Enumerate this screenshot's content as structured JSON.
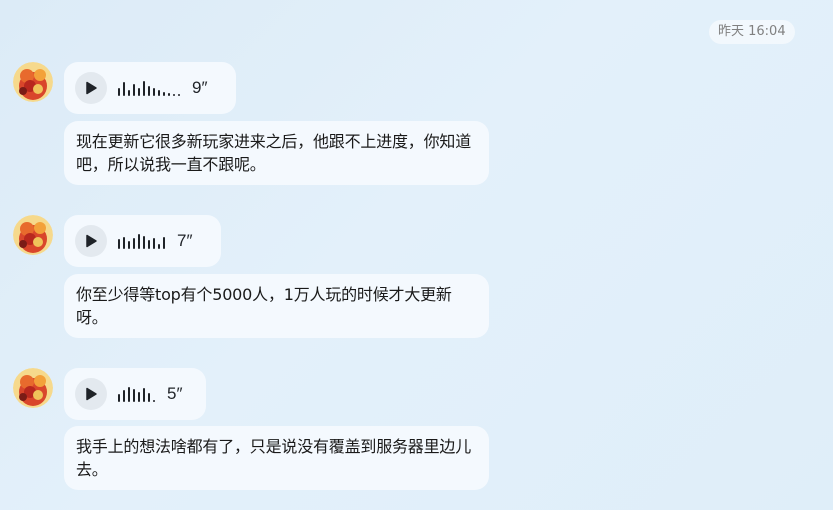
{
  "timestamp": "昨天 16:04",
  "messages": [
    {
      "sender_icon": "character-avatar",
      "voice_duration": "9″",
      "transcript": "现在更新它很多新玩家进来之后，他跟不上进度，你知道吧，所以说我一直不跟呢。"
    },
    {
      "sender_icon": "character-avatar",
      "voice_duration": "7″",
      "transcript": "你至少得等top有个5000人，1万人玩的时候才大更新呀。"
    },
    {
      "sender_icon": "character-avatar",
      "voice_duration": "5″",
      "transcript": "我手上的想法啥都有了，只是说没有覆盖到服务器里边儿去。"
    }
  ],
  "colors": {
    "background": "#dcebf7",
    "bubble": "#f4f9fe",
    "text": "#1a1a1a",
    "timestamp": "#808080"
  }
}
